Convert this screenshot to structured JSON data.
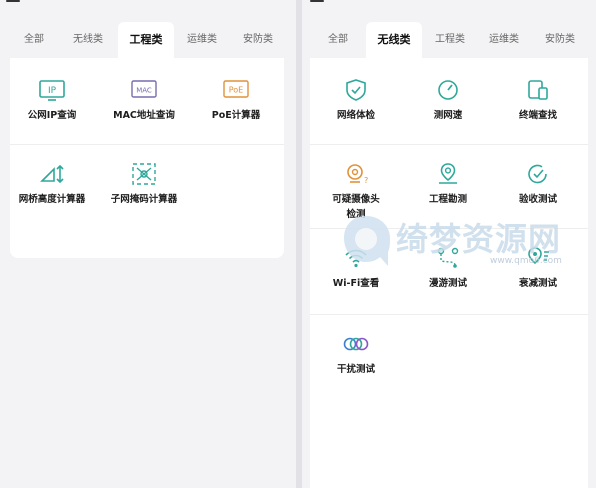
{
  "left": {
    "tabs": [
      "全部",
      "无线类",
      "工程类",
      "运维类",
      "安防类"
    ],
    "active_tab": "工程类",
    "tools": [
      {
        "icon": "ip-icon",
        "label": "公网IP查询"
      },
      {
        "icon": "mac-icon",
        "label": "MAC地址查询"
      },
      {
        "icon": "poe-icon",
        "label": "PoE计算器"
      },
      {
        "icon": "bridge-height-icon",
        "label": "网桥高度计算器"
      },
      {
        "icon": "subnet-mask-icon",
        "label": "子网掩码计算器"
      }
    ],
    "icon_text": {
      "ip": "IP",
      "mac": "MAC",
      "poe": "PoE"
    }
  },
  "right": {
    "tabs": [
      "全部",
      "无线类",
      "工程类",
      "运维类",
      "安防类"
    ],
    "active_tab": "无线类",
    "tools": [
      {
        "icon": "network-check-icon",
        "label": "网络体检"
      },
      {
        "icon": "speed-test-icon",
        "label": "测网速"
      },
      {
        "icon": "device-find-icon",
        "label": "终端查找"
      },
      {
        "icon": "suspicious-camera-icon",
        "label": "可疑摄像头检测"
      },
      {
        "icon": "site-survey-icon",
        "label": "工程勘测"
      },
      {
        "icon": "acceptance-test-icon",
        "label": "验收测试"
      },
      {
        "icon": "wifi-icon",
        "label": "Wi-Fi查看"
      },
      {
        "icon": "roaming-test-icon",
        "label": "漫游测试"
      },
      {
        "icon": "attenuation-test-icon",
        "label": "衰减测试"
      },
      {
        "icon": "interference-test-icon",
        "label": "干扰测试"
      }
    ]
  },
  "watermark": {
    "text": "绮梦资源网",
    "url": "www.qmo6.com"
  },
  "colors": {
    "accent": "#2fa89b",
    "mac_purple": "#7a6bb0",
    "poe_orange": "#e0923a",
    "interference_blue": "#3d7fd0",
    "interference_purple": "#8a57c9"
  }
}
